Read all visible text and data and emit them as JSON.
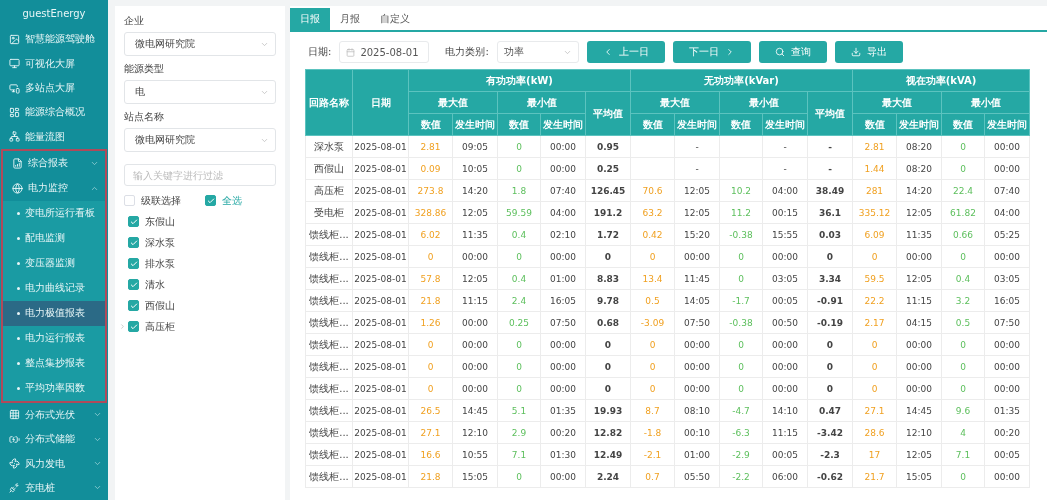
{
  "sidebar": {
    "title": "guestEnergy",
    "items": [
      {
        "label": "智慧能源驾驶舱",
        "kind": "link",
        "highlighted": false
      },
      {
        "label": "可视化大屏",
        "kind": "link",
        "highlighted": false
      },
      {
        "label": "多站点大屏",
        "kind": "link",
        "highlighted": false
      },
      {
        "label": "能源综合概况",
        "kind": "link",
        "highlighted": false
      },
      {
        "label": "能量流图",
        "kind": "link",
        "highlighted": false
      },
      {
        "label": "综合报表",
        "kind": "group",
        "expanded": false,
        "highlighted": true
      },
      {
        "label": "电力监控",
        "kind": "group",
        "expanded": true,
        "highlighted": true,
        "children": [
          {
            "label": "变电所运行看板",
            "selected": false
          },
          {
            "label": "配电监测",
            "selected": false
          },
          {
            "label": "变压器监测",
            "selected": false
          },
          {
            "label": "电力曲线记录",
            "selected": false
          },
          {
            "label": "电力极值报表",
            "selected": true
          },
          {
            "label": "电力运行报表",
            "selected": false
          },
          {
            "label": "整点集抄报表",
            "selected": false
          },
          {
            "label": "平均功率因数",
            "selected": false
          }
        ]
      },
      {
        "label": "分布式光伏",
        "kind": "group",
        "expanded": false,
        "highlighted": false
      },
      {
        "label": "分布式储能",
        "kind": "group",
        "expanded": false,
        "highlighted": false
      },
      {
        "label": "风力发电",
        "kind": "group",
        "expanded": false,
        "highlighted": false
      },
      {
        "label": "充电桩",
        "kind": "group",
        "expanded": false,
        "highlighted": false
      }
    ]
  },
  "filters": {
    "fields": [
      {
        "label": "企业",
        "value": "微电网研究院"
      },
      {
        "label": "能源类型",
        "value": "电"
      },
      {
        "label": "站点名称",
        "value": "微电网研究院"
      }
    ],
    "search": {
      "placeholder": "输入关键字进行过滤"
    },
    "cascade": {
      "label": "级联选择",
      "checked": false
    },
    "select_all": {
      "label": "全选",
      "checked": true
    },
    "tree": [
      {
        "label": "东假山",
        "checked": true
      },
      {
        "label": "深水泵",
        "checked": true
      },
      {
        "label": "排水泵",
        "checked": true
      },
      {
        "label": "清水",
        "checked": true
      },
      {
        "label": "西假山",
        "checked": true
      },
      {
        "label": "高压柜",
        "checked": true,
        "expanded": false
      }
    ]
  },
  "tabs": [
    {
      "label": "日报",
      "selected": true
    },
    {
      "label": "月报",
      "selected": false
    },
    {
      "label": "自定义",
      "selected": false
    }
  ],
  "toolbar": {
    "date_label": "日期:",
    "date": "2025-08-01",
    "category_label": "电力类别:",
    "category": "功率",
    "buttons": [
      {
        "label": "上一日",
        "kind": "prev"
      },
      {
        "label": "下一日",
        "kind": "next"
      },
      {
        "label": "查询",
        "kind": "search"
      },
      {
        "label": "导出",
        "kind": "export"
      }
    ]
  },
  "table": {
    "fixed_columns": [
      "回路名称",
      "日期"
    ],
    "groups": [
      {
        "title": "有功功率(kW)",
        "max": {
          "title": "最大值",
          "value": "数值",
          "time": "发生时间"
        },
        "min": {
          "title": "最小值",
          "value": "数值",
          "time": "发生时间"
        },
        "avg": "平均值"
      },
      {
        "title": "无功功率(kVar)",
        "max": {
          "title": "最大值",
          "value": "数值",
          "time": "发生时间"
        },
        "min": {
          "title": "最小值",
          "value": "数值",
          "time": "发生时间"
        },
        "avg": "平均值"
      },
      {
        "title": "视在功率(kVA)",
        "max": {
          "title": "最大值",
          "value": "数值",
          "time": "发生时间"
        },
        "min": {
          "title": "最小值",
          "value": "数值",
          "time": "发生时间"
        }
      }
    ],
    "rows": [
      {
        "name": "深水泵",
        "date": "2025-08-01",
        "cells": {
          "c0": "2.81",
          "c1": "09:05",
          "c2": "0",
          "c3": "00:00",
          "c4": "0.95",
          "c6": "-",
          "c8": "-",
          "c9": "-",
          "c10": "2.81",
          "c11": "08:20",
          "c12": "0",
          "c13": "00:00"
        }
      },
      {
        "name": "西假山",
        "date": "2025-08-01",
        "cells": {
          "c0": "0.09",
          "c1": "10:05",
          "c2": "0",
          "c3": "00:00",
          "c4": "0.25",
          "c6": "-",
          "c8": "-",
          "c9": "-",
          "c10": "1.44",
          "c11": "08:20",
          "c12": "0",
          "c13": "00:00"
        }
      },
      {
        "name": "高压柜",
        "date": "2025-08-01",
        "values": [
          "273.8",
          "14:20",
          "1.8",
          "07:40",
          "126.45",
          "70.6",
          "12:05",
          "10.2",
          "04:00",
          "38.49",
          "281",
          "14:20",
          "22.4",
          "07:40"
        ]
      },
      {
        "name": "受电柜",
        "date": "2025-08-01",
        "values": [
          "328.86",
          "12:05",
          "59.59",
          "04:00",
          "191.2",
          "63.2",
          "12:05",
          "11.2",
          "00:15",
          "36.1",
          "335.12",
          "12:05",
          "61.82",
          "04:00"
        ]
      },
      {
        "name": "馈线柜...",
        "date": "2025-08-01",
        "values": [
          "6.02",
          "11:35",
          "0.4",
          "02:10",
          "1.72",
          "0.42",
          "15:20",
          "-0.38",
          "15:55",
          "0.03",
          "6.09",
          "11:35",
          "0.66",
          "05:25"
        ]
      },
      {
        "name": "馈线柜...",
        "date": "2025-08-01",
        "values": [
          "0",
          "00:00",
          "0",
          "00:00",
          "0",
          "0",
          "00:00",
          "0",
          "00:00",
          "0",
          "0",
          "00:00",
          "0",
          "00:00"
        ]
      },
      {
        "name": "馈线柜...",
        "date": "2025-08-01",
        "values": [
          "57.8",
          "12:05",
          "0.4",
          "01:00",
          "8.83",
          "13.4",
          "11:45",
          "0",
          "03:05",
          "3.34",
          "59.5",
          "12:05",
          "0.4",
          "03:05"
        ]
      },
      {
        "name": "馈线柜...",
        "date": "2025-08-01",
        "values": [
          "21.8",
          "11:15",
          "2.4",
          "16:05",
          "9.78",
          "0.5",
          "14:05",
          "-1.7",
          "00:05",
          "-0.91",
          "22.2",
          "11:15",
          "3.2",
          "16:05"
        ]
      },
      {
        "name": "馈线柜...",
        "date": "2025-08-01",
        "values": [
          "1.26",
          "00:00",
          "0.25",
          "07:50",
          "0.68",
          "-3.09",
          "07:50",
          "-0.38",
          "00:50",
          "-0.19",
          "2.17",
          "04:15",
          "0.5",
          "07:50"
        ]
      },
      {
        "name": "馈线柜...",
        "date": "2025-08-01",
        "values": [
          "0",
          "00:00",
          "0",
          "00:00",
          "0",
          "0",
          "00:00",
          "0",
          "00:00",
          "0",
          "0",
          "00:00",
          "0",
          "00:00"
        ]
      },
      {
        "name": "馈线柜...",
        "date": "2025-08-01",
        "values": [
          "0",
          "00:00",
          "0",
          "00:00",
          "0",
          "0",
          "00:00",
          "0",
          "00:00",
          "0",
          "0",
          "00:00",
          "0",
          "00:00"
        ]
      },
      {
        "name": "馈线柜...",
        "date": "2025-08-01",
        "values": [
          "0",
          "00:00",
          "0",
          "00:00",
          "0",
          "0",
          "00:00",
          "0",
          "00:00",
          "0",
          "0",
          "00:00",
          "0",
          "00:00"
        ]
      },
      {
        "name": "馈线柜...",
        "date": "2025-08-01",
        "values": [
          "26.5",
          "14:45",
          "5.1",
          "01:35",
          "19.93",
          "8.7",
          "08:10",
          "-4.7",
          "14:10",
          "0.47",
          "27.1",
          "14:45",
          "9.6",
          "01:35"
        ]
      },
      {
        "name": "馈线柜...",
        "date": "2025-08-01",
        "values": [
          "27.1",
          "12:10",
          "2.9",
          "00:20",
          "12.82",
          "-1.8",
          "00:10",
          "-6.3",
          "11:15",
          "-3.42",
          "28.6",
          "12:10",
          "4",
          "00:20"
        ]
      },
      {
        "name": "馈线柜...",
        "date": "2025-08-01",
        "values": [
          "16.6",
          "10:55",
          "7.1",
          "01:30",
          "12.49",
          "-2.1",
          "01:00",
          "-2.9",
          "00:05",
          "-2.3",
          "17",
          "12:05",
          "7.1",
          "00:05"
        ]
      },
      {
        "name": "馈线柜...",
        "date": "2025-08-01",
        "values": [
          "21.8",
          "15:05",
          "0",
          "00:00",
          "2.24",
          "0.7",
          "05:50",
          "-2.2",
          "06:00",
          "-0.62",
          "21.7",
          "15:05",
          "0",
          "00:00"
        ]
      }
    ]
  }
}
